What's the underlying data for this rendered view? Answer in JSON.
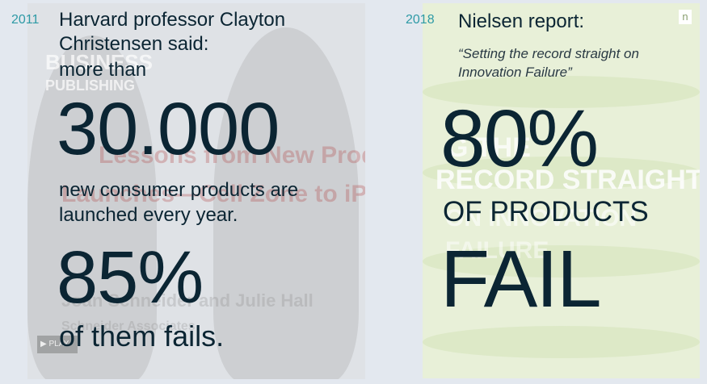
{
  "left": {
    "year": "2011",
    "intro_line1": "Harvard professor Clayton",
    "intro_line2": "Christensen said:",
    "intro_line3": "more than",
    "big_number": "30.000",
    "desc_line1": "new consumer products are",
    "desc_line2": "launched every year.",
    "percent": "85%",
    "fails_text": "of them fails.",
    "background": {
      "logo_line1": "BUSINESS",
      "logo_line2": "PUBLISHING",
      "red_line1": "Lessons from New Product",
      "red_line2": "Launches—Cell Zone to iPad",
      "name_line": "Joan Schneider and Julie Hall",
      "org_line": "Schneider Associates",
      "play_label": "▶ PLAY"
    }
  },
  "right": {
    "year": "2018",
    "title": "Nielsen report:",
    "quote_line1": "“Setting the record straight on",
    "quote_line2": "Innovation Failure”",
    "percent": "80%",
    "products_text": "OF PRODUCTS",
    "fail_text": "FAIL",
    "background": {
      "bg_line1": "G THE",
      "bg_line2": "RECORD STRAIGHT",
      "bg_line3": "ON INNOVATION",
      "bg_line4": "FAILURE",
      "corner_letter": "n"
    }
  },
  "colors": {
    "year": "#2e9aa6",
    "text": "#0b2533",
    "page_bg": "#e3e8ef"
  }
}
